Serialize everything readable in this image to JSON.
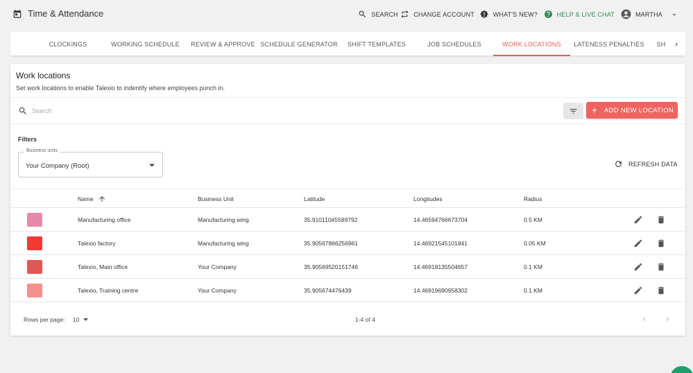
{
  "app": {
    "title": "Time & Attendance",
    "icon": "calendar-icon"
  },
  "top_actions": {
    "search_label": "SEARCH",
    "change_account_label": "CHANGE ACCOUNT",
    "whats_new_label": "WHAT'S NEW?",
    "help_label": "HELP & LIVE CHAT",
    "user_label": "MARTHA"
  },
  "tabs": [
    {
      "label": "CLOCKINGS"
    },
    {
      "label": "WORKING SCHEDULE"
    },
    {
      "label": "REVIEW & APPROVE"
    },
    {
      "label": "SCHEDULE GENERATOR"
    },
    {
      "label": "SHIFT TEMPLATES"
    },
    {
      "label": "JOB SCHEDULES"
    },
    {
      "label": "WORK LOCATIONS"
    },
    {
      "label": "LATENESS PENALTIES"
    },
    {
      "label": "SH"
    }
  ],
  "active_tab": "WORK LOCATIONS",
  "page": {
    "title": "Work locations",
    "subtitle": "Set work locations to enable Talexio to indentify where employees punch in."
  },
  "search": {
    "placeholder": "Search",
    "value": ""
  },
  "add_button_label": "ADD NEW LOCATION",
  "filters": {
    "label": "Filters",
    "business_units_legend": "Business units",
    "business_units_value": "Your Company (Root)"
  },
  "refresh_label": "REFRESH DATA",
  "table": {
    "columns": [
      "Name",
      "Business Unit",
      "Latitude",
      "Longitudes",
      "Radius"
    ],
    "sort_column": "Name",
    "sort_direction": "ascending",
    "rows": [
      {
        "color": "#e58aab",
        "name": "Manufacturing office",
        "business_unit": "Manufacturing wing",
        "latitude": "35.91011045589792",
        "longitude": "14.46594766673704",
        "radius": "0.5 KM"
      },
      {
        "color": "#f23a36",
        "name": "Talexio factory",
        "business_unit": "Manufacturing wing",
        "latitude": "35.90567866256961",
        "longitude": "14.46921545101841",
        "radius": "0.05 KM"
      },
      {
        "color": "#de5856",
        "name": "Talexio, Main office",
        "business_unit": "Your Company",
        "latitude": "35.90569520151746",
        "longitude": "14.46918135504657",
        "radius": "0.1 KM"
      },
      {
        "color": "#f4918d",
        "name": "Talexio, Training centre",
        "business_unit": "Your Company",
        "latitude": "35.905674476439",
        "longitude": "14.46919690958302",
        "radius": "0.1 KM"
      }
    ]
  },
  "pagination": {
    "rows_per_page_label": "Rows per page:",
    "rows_per_page_value": "10",
    "range_label": "1-4 of 4"
  },
  "colors": {
    "accent": "#ea5a55",
    "primary_button": "#ef6461",
    "help_green": "#2e8b57",
    "fab_green": "#1e9e6a"
  }
}
